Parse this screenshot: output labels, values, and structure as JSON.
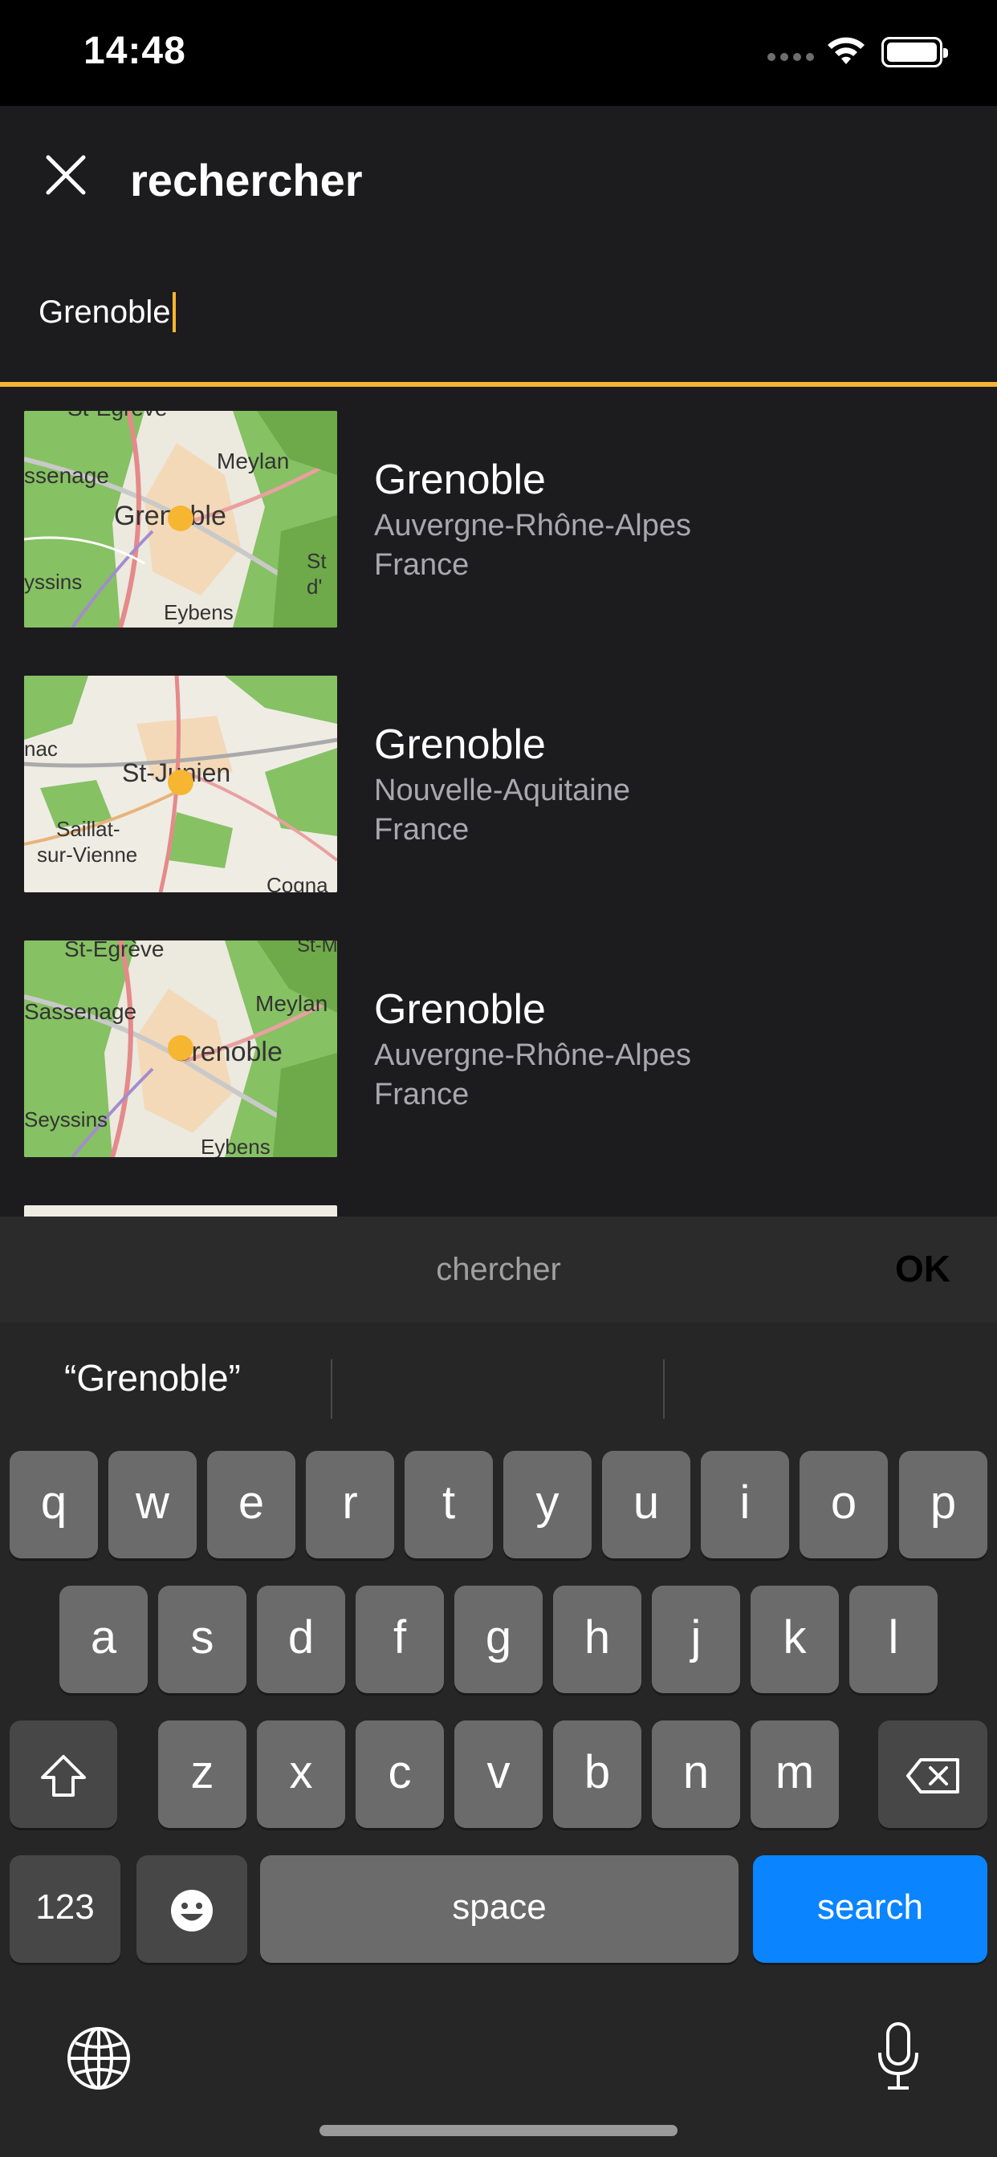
{
  "status": {
    "time": "14:48"
  },
  "header": {
    "title": "rechercher",
    "search_value": "Grenoble",
    "accent_color": "#f6b632"
  },
  "results": [
    {
      "name": "Grenoble",
      "region": "Auvergne-Rhône-Alpes",
      "country": "France",
      "map_labels": [
        "St-Egrève",
        "ssenage",
        "Meylan",
        "Grenoble",
        "yssins",
        "Eybens",
        "St",
        "d'"
      ]
    },
    {
      "name": "Grenoble",
      "region": "Nouvelle-Aquitaine",
      "country": "France",
      "map_labels": [
        "nac",
        "St-Junien",
        "Saillat-",
        "sur-Vienne",
        "Cogna"
      ]
    },
    {
      "name": "Grenoble",
      "region": "Auvergne-Rhône-Alpes",
      "country": "France",
      "map_labels": [
        "St-Egrève",
        "Sassenage",
        "Meylan",
        "Grenoble",
        "Seyssins",
        "Eybens",
        "St-M"
      ]
    }
  ],
  "keyboard": {
    "toolbar_hint": "chercher",
    "toolbar_ok": "OK",
    "suggestion": "“Grenoble”",
    "row1": [
      "q",
      "w",
      "e",
      "r",
      "t",
      "y",
      "u",
      "i",
      "o",
      "p"
    ],
    "row2": [
      "a",
      "s",
      "d",
      "f",
      "g",
      "h",
      "j",
      "k",
      "l"
    ],
    "row3": [
      "z",
      "x",
      "c",
      "v",
      "b",
      "n",
      "m"
    ],
    "numbers_label": "123",
    "space_label": "space",
    "search_label": "search",
    "search_color": "#0a84ff"
  }
}
